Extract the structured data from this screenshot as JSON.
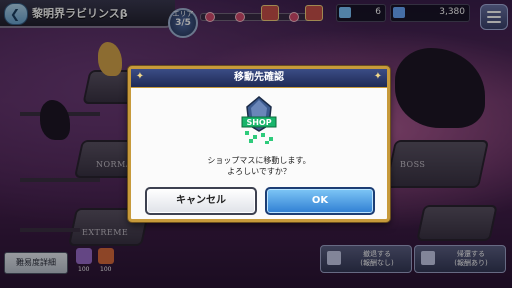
{
  "header": {
    "title": "黎明界ラビリンスβ",
    "area_label": "エリア",
    "area_progress": "3/5"
  },
  "resources": [
    {
      "name": "ticket",
      "value": "6",
      "color": "#7fc7ff"
    },
    {
      "name": "gems",
      "value": "3,380",
      "color": "#6aa9ff"
    }
  ],
  "map_labels": {
    "normal": "NORMAL",
    "boss": "BOSS",
    "extreme": "EXTREME"
  },
  "bottom": {
    "detail_button": "難易度詳細",
    "icons": [
      {
        "name": "item-icon-a",
        "caption": "100",
        "color": "#9a6ccb"
      },
      {
        "name": "item-icon-b",
        "caption": "100",
        "color": "#d96b3c"
      }
    ],
    "withdraw_button": {
      "line1": "撤退する",
      "line2": "(報酬なし)"
    },
    "finish_button": {
      "line1": "帰還する",
      "line2": "(報酬あり)"
    }
  },
  "dialog": {
    "title": "移動先確認",
    "icon_label": "SHOP",
    "message_line1": "ショップマスに移動します。",
    "message_line2": "よろしいですか？",
    "cancel_label": "キャンセル",
    "ok_label": "OK"
  },
  "colors": {
    "dialog_border": "#c79a3b",
    "header_blue": "#1f2a55",
    "ok_blue": "#2f7ed3"
  }
}
